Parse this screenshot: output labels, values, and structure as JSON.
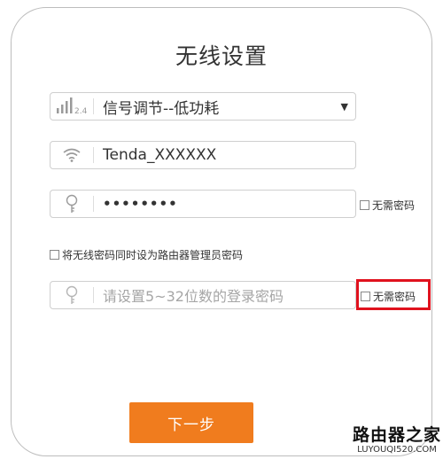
{
  "page": {
    "title": "无线设置"
  },
  "signal": {
    "band_badge": "2.4",
    "value": "信号调节--低功耗"
  },
  "ssid": {
    "value": "Tenda_XXXXXX"
  },
  "wifi_password": {
    "value": "••••••••",
    "no_password_label": "无需密码"
  },
  "sync": {
    "label": "将无线密码同时设为路由器管理员密码"
  },
  "admin_password": {
    "placeholder": "请设置5~32位数的登录密码",
    "no_password_label": "无需密码"
  },
  "actions": {
    "next_label": "下一步"
  },
  "watermark": {
    "line1": "路由器之家",
    "line2": "LUYOUQI520.COM"
  },
  "colors": {
    "accent": "#f07c1e",
    "highlight": "#e0121e"
  },
  "icons": [
    "signal-strength-icon",
    "wifi-icon",
    "lock-icon",
    "lock-icon",
    "dropdown-arrow-icon"
  ]
}
